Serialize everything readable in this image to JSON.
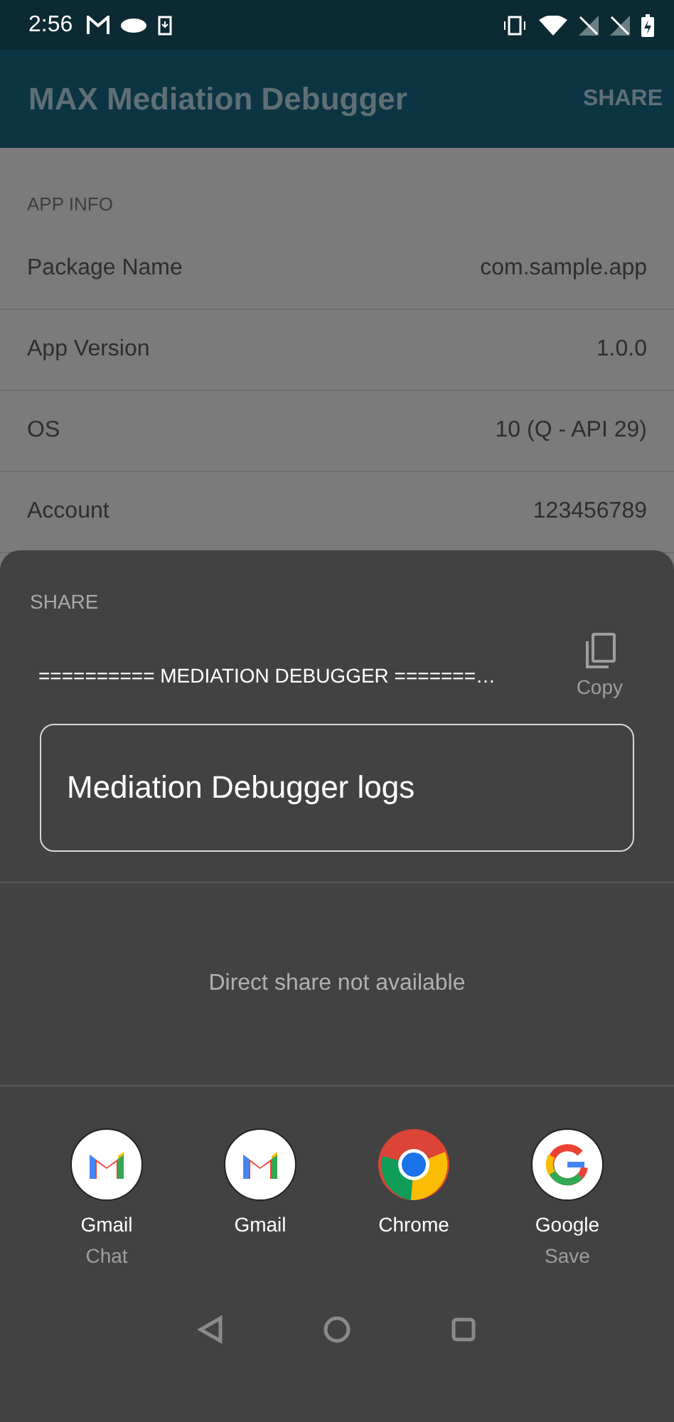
{
  "status_bar": {
    "time": "2:56"
  },
  "app_bar": {
    "title": "MAX Mediation Debugger",
    "action": "SHARE"
  },
  "app_info": {
    "header": "APP INFO",
    "rows": [
      {
        "label": "Package Name",
        "value": "com.sample.app"
      },
      {
        "label": "App Version",
        "value": "1.0.0"
      },
      {
        "label": "OS",
        "value": "10 (Q - API 29)"
      },
      {
        "label": "Account",
        "value": "123456789"
      }
    ]
  },
  "share_sheet": {
    "title": "SHARE",
    "preview_text": "========== MEDIATION DEBUGGER =======…",
    "copy_label": "Copy",
    "subject": "Mediation Debugger logs",
    "direct_share_message": "Direct share not available",
    "apps": [
      {
        "kind": "gmail",
        "name": "Gmail",
        "subtitle": "Chat"
      },
      {
        "kind": "gmail",
        "name": "Gmail"
      },
      {
        "kind": "chrome",
        "name": "Chrome"
      },
      {
        "kind": "google",
        "name": "Google",
        "subtitle": "Save"
      }
    ]
  }
}
